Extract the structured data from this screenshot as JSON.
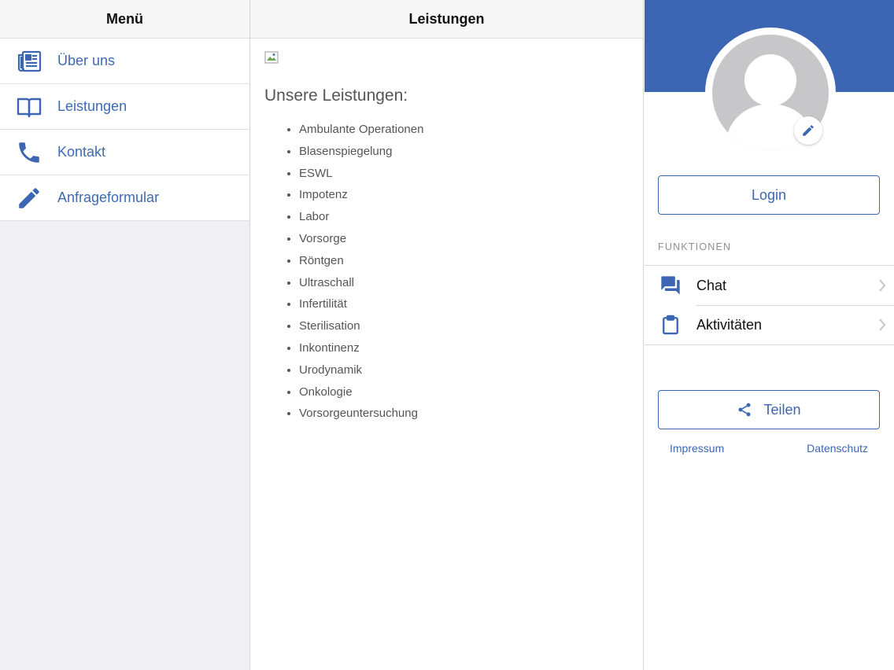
{
  "menu": {
    "title": "Menü",
    "items": [
      {
        "label": "Über uns",
        "icon": "newspaper-icon"
      },
      {
        "label": "Leistungen",
        "icon": "book-icon"
      },
      {
        "label": "Kontakt",
        "icon": "phone-icon"
      },
      {
        "label": "Anfrageformular",
        "icon": "pencil-icon"
      }
    ]
  },
  "content": {
    "title": "Leistungen",
    "heading": "Unsere Leistungen:",
    "services": [
      "Ambulante Operationen",
      "Blasenspiegelung",
      "ESWL",
      "Impotenz",
      "Labor",
      "Vorsorge",
      "Röntgen",
      "Ultraschall",
      "Infertilität",
      "Sterilisation",
      "Inkontinenz",
      "Urodynamik",
      "Onkologie",
      "Vorsorgeuntersuchung"
    ]
  },
  "panel": {
    "login_label": "Login",
    "section_label": "FUNKTIONEN",
    "functions": [
      {
        "label": "Chat",
        "icon": "chat-icon"
      },
      {
        "label": "Aktivitäten",
        "icon": "clipboard-icon"
      }
    ],
    "share_label": "Teilen",
    "impressum_label": "Impressum",
    "datenschutz_label": "Datenschutz"
  },
  "colors": {
    "accent": "#3c65b3",
    "menu_bg": "#efeff4",
    "text_gray": "#555555"
  }
}
